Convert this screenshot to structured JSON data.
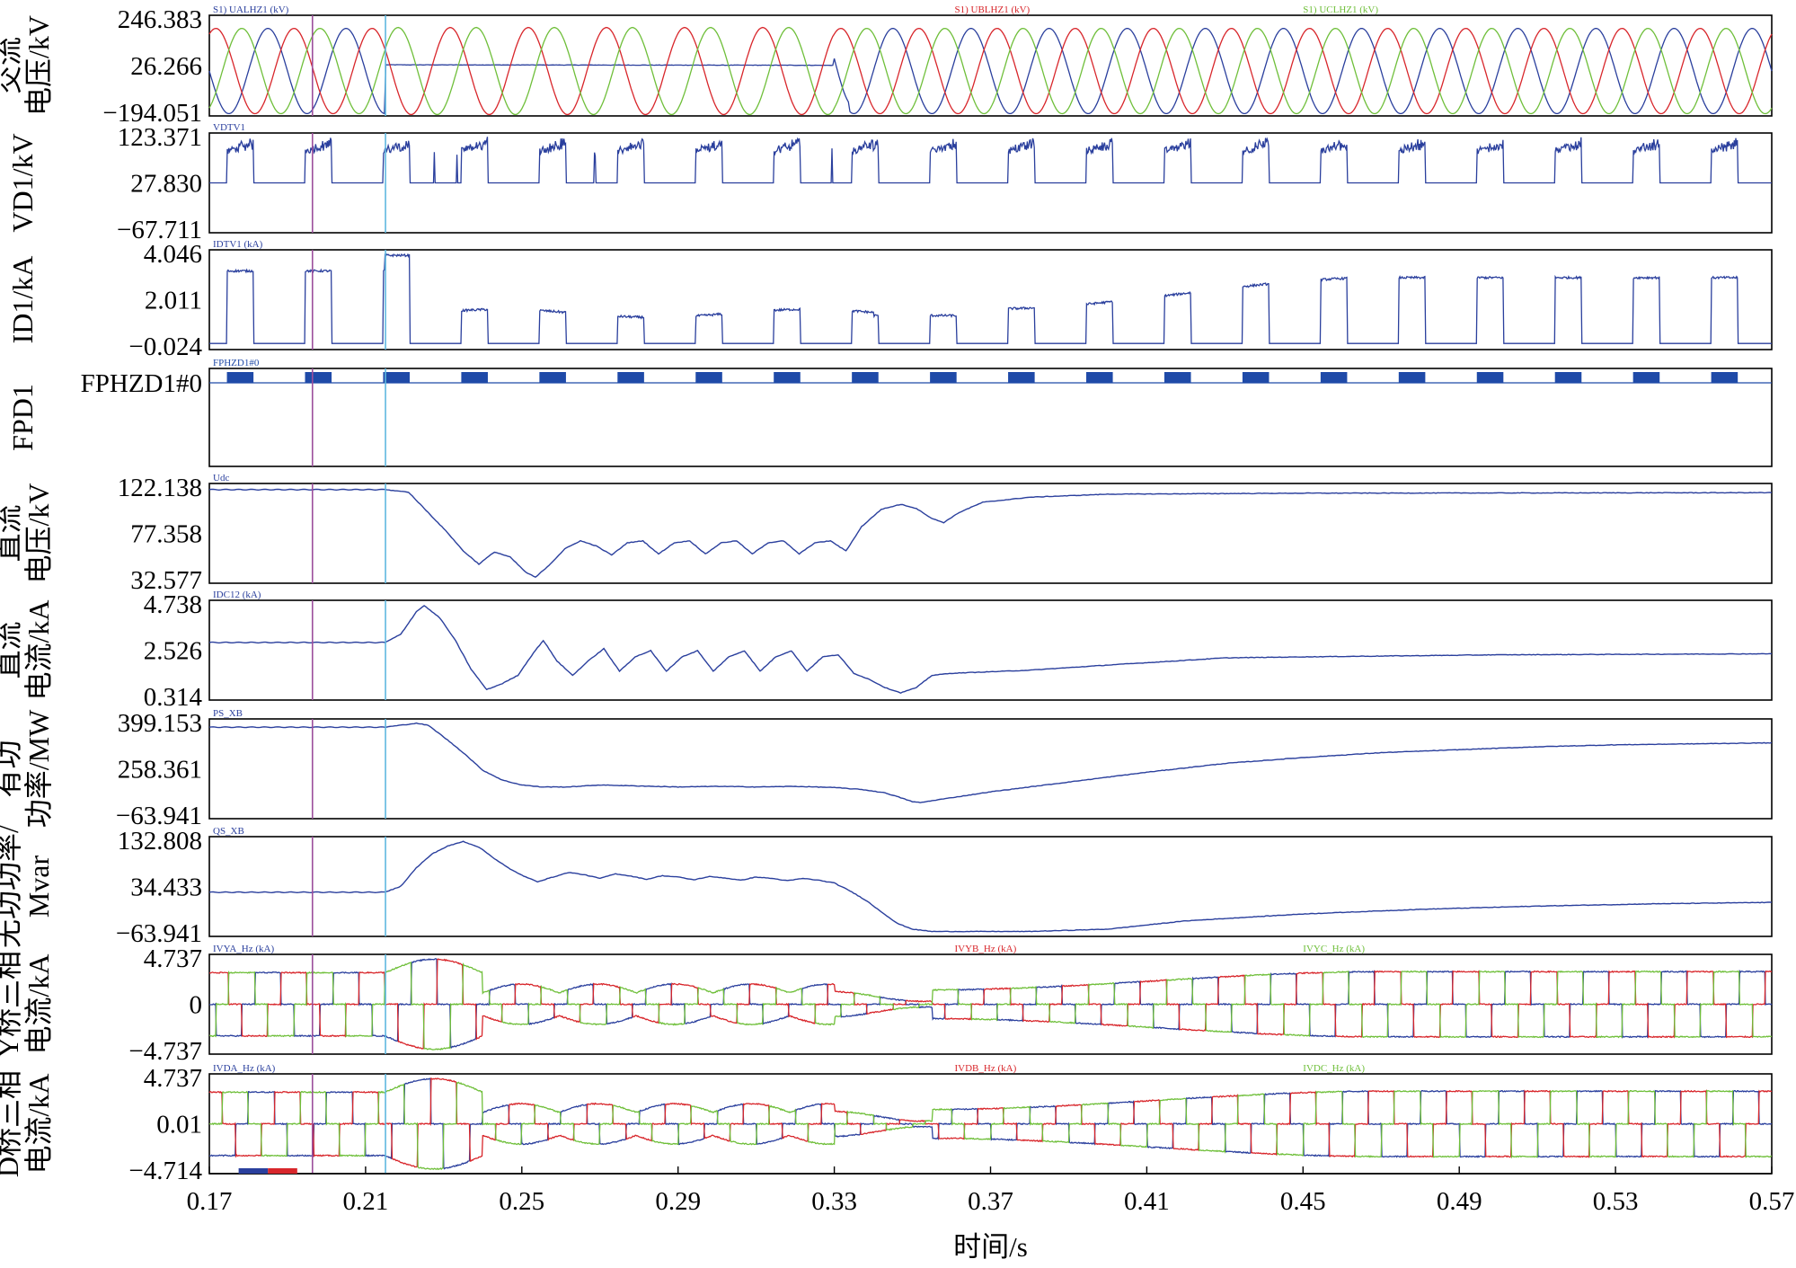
{
  "colors": {
    "blue": "#2a3f9d",
    "red": "#d8262b",
    "green": "#6fbf3a",
    "marker_purple": "#9c4f9c",
    "marker_cyan": "#5fb8e0",
    "pulse_blue": "#1f4aa8",
    "axis": "#000000"
  },
  "chart_data": {
    "type": "line",
    "xlabel": "时间/s",
    "xlim": [
      0.17,
      0.57
    ],
    "xticks": [
      "0.17",
      "0.21",
      "0.25",
      "0.29",
      "0.33",
      "0.37",
      "0.41",
      "0.45",
      "0.49",
      "0.53",
      "0.57"
    ],
    "markers": [
      0.1964,
      0.2151
    ],
    "panels": [
      {
        "id": "ac_voltage",
        "ylabel_lines": [
          "交流",
          "电压/kV"
        ],
        "yticks": [
          "246.383",
          "26.266",
          "−194.051"
        ],
        "ylim": [
          -194.051,
          246.383
        ],
        "series": [
          {
            "name": "S1) UALHZ1 (kV)",
            "color": "blue"
          },
          {
            "name": "S1) UBLHZ1 (kV)",
            "color": "red"
          },
          {
            "name": "S1) UCLHZ1 (kV)",
            "color": "green"
          }
        ],
        "kind": "ac3"
      },
      {
        "id": "vd1",
        "ylabel_lines": [
          "VD1/kV"
        ],
        "yticks": [
          "123.371",
          "27.830",
          "−67.711"
        ],
        "ylim": [
          -67.711,
          123.371
        ],
        "series": [
          {
            "name": "VDTV1",
            "color": "blue"
          }
        ],
        "kind": "vd"
      },
      {
        "id": "id1",
        "ylabel_lines": [
          "ID1/kA"
        ],
        "yticks": [
          "4.046",
          "2.011",
          "−0.024"
        ],
        "ylim": [
          -0.024,
          4.046
        ],
        "series": [
          {
            "name": "IDTV1 (kA)",
            "color": "blue"
          }
        ],
        "kind": "id"
      },
      {
        "id": "fp",
        "ylabel_lines": [
          "FPD1"
        ],
        "yticks": [
          "FPHZD1#0"
        ],
        "series": [
          {
            "name": "FPHZD1#0",
            "color": "pulse_blue"
          }
        ],
        "kind": "fp"
      },
      {
        "id": "udc",
        "ylabel_lines": [
          "直流",
          "电压/kV"
        ],
        "yticks": [
          "122.138",
          "77.358",
          "32.577"
        ],
        "ylim": [
          32.577,
          122.138
        ],
        "series": [
          {
            "name": "Udc",
            "color": "blue"
          }
        ],
        "kind": "udc",
        "points": [
          [
            0.17,
            120.5
          ],
          [
            0.215,
            120.5
          ],
          [
            0.221,
            118
          ],
          [
            0.226,
            98
          ],
          [
            0.231,
            78
          ],
          [
            0.235,
            60
          ],
          [
            0.239,
            47
          ],
          [
            0.243,
            59
          ],
          [
            0.247,
            54
          ],
          [
            0.251,
            39
          ],
          [
            0.2535,
            34
          ],
          [
            0.257,
            46
          ],
          [
            0.261,
            62
          ],
          [
            0.265,
            70
          ],
          [
            0.269,
            65
          ],
          [
            0.273,
            56
          ],
          [
            0.277,
            68
          ],
          [
            0.281,
            70
          ],
          [
            0.285,
            57
          ],
          [
            0.289,
            68
          ],
          [
            0.293,
            70
          ],
          [
            0.297,
            57
          ],
          [
            0.301,
            68
          ],
          [
            0.305,
            70
          ],
          [
            0.309,
            57
          ],
          [
            0.313,
            68
          ],
          [
            0.317,
            70
          ],
          [
            0.321,
            57
          ],
          [
            0.325,
            68
          ],
          [
            0.329,
            70
          ],
          [
            0.333,
            60
          ],
          [
            0.337,
            84
          ],
          [
            0.342,
            101
          ],
          [
            0.347,
            106
          ],
          [
            0.351,
            102
          ],
          [
            0.355,
            92
          ],
          [
            0.358,
            88
          ],
          [
            0.362,
            98
          ],
          [
            0.368,
            108
          ],
          [
            0.38,
            113
          ],
          [
            0.4,
            116
          ],
          [
            0.45,
            117
          ],
          [
            0.57,
            117.5
          ]
        ]
      },
      {
        "id": "idc",
        "ylabel_lines": [
          "直流",
          "电流/kA"
        ],
        "yticks": [
          "4.738",
          "2.526",
          "0.314"
        ],
        "ylim": [
          0.314,
          4.738
        ],
        "series": [
          {
            "name": "IDC12 (kA)",
            "color": "blue"
          }
        ],
        "kind": "idc",
        "points": [
          [
            0.17,
            2.9
          ],
          [
            0.215,
            2.9
          ],
          [
            0.219,
            3.3
          ],
          [
            0.223,
            4.4
          ],
          [
            0.225,
            4.7
          ],
          [
            0.229,
            4.1
          ],
          [
            0.233,
            3.0
          ],
          [
            0.237,
            1.6
          ],
          [
            0.241,
            0.6
          ],
          [
            0.245,
            0.9
          ],
          [
            0.249,
            1.3
          ],
          [
            0.253,
            2.4
          ],
          [
            0.2555,
            3.0
          ],
          [
            0.259,
            2.0
          ],
          [
            0.263,
            1.3
          ],
          [
            0.267,
            2.0
          ],
          [
            0.271,
            2.6
          ],
          [
            0.275,
            1.5
          ],
          [
            0.279,
            2.2
          ],
          [
            0.283,
            2.5
          ],
          [
            0.287,
            1.5
          ],
          [
            0.291,
            2.2
          ],
          [
            0.295,
            2.5
          ],
          [
            0.299,
            1.5
          ],
          [
            0.303,
            2.2
          ],
          [
            0.307,
            2.5
          ],
          [
            0.311,
            1.5
          ],
          [
            0.315,
            2.2
          ],
          [
            0.319,
            2.5
          ],
          [
            0.323,
            1.5
          ],
          [
            0.327,
            2.2
          ],
          [
            0.331,
            2.3
          ],
          [
            0.335,
            1.4
          ],
          [
            0.339,
            1.1
          ],
          [
            0.343,
            0.7
          ],
          [
            0.347,
            0.45
          ],
          [
            0.351,
            0.7
          ],
          [
            0.355,
            1.3
          ],
          [
            0.36,
            1.4
          ],
          [
            0.38,
            1.55
          ],
          [
            0.4,
            1.8
          ],
          [
            0.43,
            2.15
          ],
          [
            0.45,
            2.2
          ],
          [
            0.5,
            2.3
          ],
          [
            0.57,
            2.35
          ]
        ]
      },
      {
        "id": "ps",
        "ylabel_lines": [
          "有功",
          "功率/MW"
        ],
        "yticks": [
          "399.153",
          "258.361",
          "−63.941"
        ],
        "ylim": [
          -63.941,
          399.153
        ],
        "series": [
          {
            "name": "PS_XB",
            "color": "blue"
          }
        ],
        "kind": "ps",
        "points": [
          [
            0.17,
            380
          ],
          [
            0.215,
            380
          ],
          [
            0.219,
            390
          ],
          [
            0.223,
            400
          ],
          [
            0.226,
            390
          ],
          [
            0.23,
            330
          ],
          [
            0.235,
            250
          ],
          [
            0.24,
            160
          ],
          [
            0.245,
            110
          ],
          [
            0.25,
            85
          ],
          [
            0.255,
            75
          ],
          [
            0.262,
            75
          ],
          [
            0.27,
            85
          ],
          [
            0.28,
            80
          ],
          [
            0.29,
            75
          ],
          [
            0.3,
            78
          ],
          [
            0.31,
            75
          ],
          [
            0.32,
            78
          ],
          [
            0.33,
            72
          ],
          [
            0.337,
            62
          ],
          [
            0.343,
            45
          ],
          [
            0.347,
            20
          ],
          [
            0.35,
            0
          ],
          [
            0.352,
            -5
          ],
          [
            0.356,
            8
          ],
          [
            0.37,
            50
          ],
          [
            0.39,
            100
          ],
          [
            0.41,
            150
          ],
          [
            0.43,
            195
          ],
          [
            0.45,
            225
          ],
          [
            0.47,
            250
          ],
          [
            0.49,
            265
          ],
          [
            0.51,
            280
          ],
          [
            0.53,
            290
          ],
          [
            0.55,
            295
          ],
          [
            0.57,
            300
          ]
        ]
      },
      {
        "id": "qs",
        "ylabel_lines": [
          "无功功率/",
          "Mvar"
        ],
        "yticks": [
          "132.808",
          "34.433",
          "−63.941"
        ],
        "ylim": [
          -63.941,
          132.808
        ],
        "series": [
          {
            "name": "QS_XB",
            "color": "blue"
          }
        ],
        "kind": "qs",
        "points": [
          [
            0.17,
            22
          ],
          [
            0.215,
            22
          ],
          [
            0.219,
            35
          ],
          [
            0.223,
            75
          ],
          [
            0.227,
            105
          ],
          [
            0.231,
            122
          ],
          [
            0.235,
            132
          ],
          [
            0.239,
            120
          ],
          [
            0.243,
            95
          ],
          [
            0.247,
            72
          ],
          [
            0.251,
            55
          ],
          [
            0.254,
            45
          ],
          [
            0.258,
            55
          ],
          [
            0.262,
            65
          ],
          [
            0.266,
            60
          ],
          [
            0.27,
            52
          ],
          [
            0.274,
            62
          ],
          [
            0.278,
            57
          ],
          [
            0.282,
            50
          ],
          [
            0.286,
            58
          ],
          [
            0.29,
            55
          ],
          [
            0.294,
            49
          ],
          [
            0.298,
            56
          ],
          [
            0.302,
            53
          ],
          [
            0.306,
            48
          ],
          [
            0.31,
            55
          ],
          [
            0.314,
            52
          ],
          [
            0.318,
            47
          ],
          [
            0.322,
            52
          ],
          [
            0.326,
            48
          ],
          [
            0.33,
            42
          ],
          [
            0.334,
            25
          ],
          [
            0.338,
            5
          ],
          [
            0.342,
            -20
          ],
          [
            0.346,
            -45
          ],
          [
            0.35,
            -58
          ],
          [
            0.355,
            -63
          ],
          [
            0.38,
            -63
          ],
          [
            0.4,
            -58
          ],
          [
            0.42,
            -40
          ],
          [
            0.45,
            -25
          ],
          [
            0.48,
            -15
          ],
          [
            0.51,
            -8
          ],
          [
            0.54,
            -3
          ],
          [
            0.57,
            0
          ]
        ]
      },
      {
        "id": "y_bridge",
        "ylabel_lines": [
          "Y桥三相",
          "电流/kA"
        ],
        "yticks": [
          "4.737",
          "0",
          "−4.737"
        ],
        "ylim": [
          -4.737,
          4.737
        ],
        "series": [
          {
            "name": "IVYA_Hz (kA)",
            "color": "blue"
          },
          {
            "name": "IVYB_Hz (kA)",
            "color": "red"
          },
          {
            "name": "IVYC_Hz (kA)",
            "color": "green"
          }
        ],
        "kind": "bridge"
      },
      {
        "id": "d_bridge",
        "ylabel_lines": [
          "D桥三相",
          "电流/kA"
        ],
        "yticks": [
          "4.737",
          "0.01",
          "−4.714"
        ],
        "ylim": [
          -4.714,
          4.737
        ],
        "series": [
          {
            "name": "IVDA_Hz (kA)",
            "color": "blue"
          },
          {
            "name": "IVDB_Hz (kA)",
            "color": "red"
          },
          {
            "name": "IVDC_Hz (kA)",
            "color": "green"
          }
        ],
        "kind": "bridge"
      }
    ]
  }
}
